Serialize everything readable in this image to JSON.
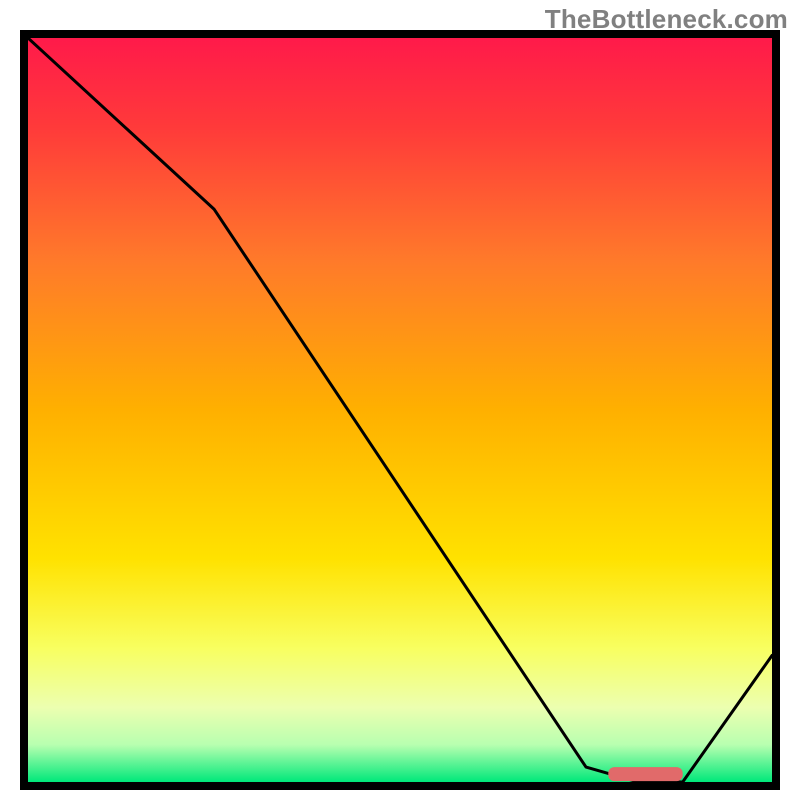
{
  "watermark": "TheBottleneck.com",
  "chart_data": {
    "type": "line",
    "title": "",
    "xlabel": "",
    "ylabel": "",
    "xlim": [
      0,
      100
    ],
    "ylim": [
      0,
      100
    ],
    "series": [
      {
        "name": "bottleneck-curve",
        "x": [
          0,
          25,
          75,
          82,
          88,
          100
        ],
        "y": [
          100,
          77,
          2,
          0,
          0,
          17
        ]
      }
    ],
    "marker": {
      "name": "optimal-range",
      "x_start": 78,
      "x_end": 88,
      "y": 1.2,
      "color": "#e16a6a"
    },
    "gradient_stops": [
      {
        "offset": 0.0,
        "color": "#ff1a4a"
      },
      {
        "offset": 0.12,
        "color": "#ff3a3a"
      },
      {
        "offset": 0.3,
        "color": "#ff7a2a"
      },
      {
        "offset": 0.5,
        "color": "#ffb000"
      },
      {
        "offset": 0.7,
        "color": "#ffe200"
      },
      {
        "offset": 0.82,
        "color": "#f8ff60"
      },
      {
        "offset": 0.9,
        "color": "#ecffb0"
      },
      {
        "offset": 0.95,
        "color": "#b8ffb0"
      },
      {
        "offset": 1.0,
        "color": "#00e87a"
      }
    ]
  }
}
